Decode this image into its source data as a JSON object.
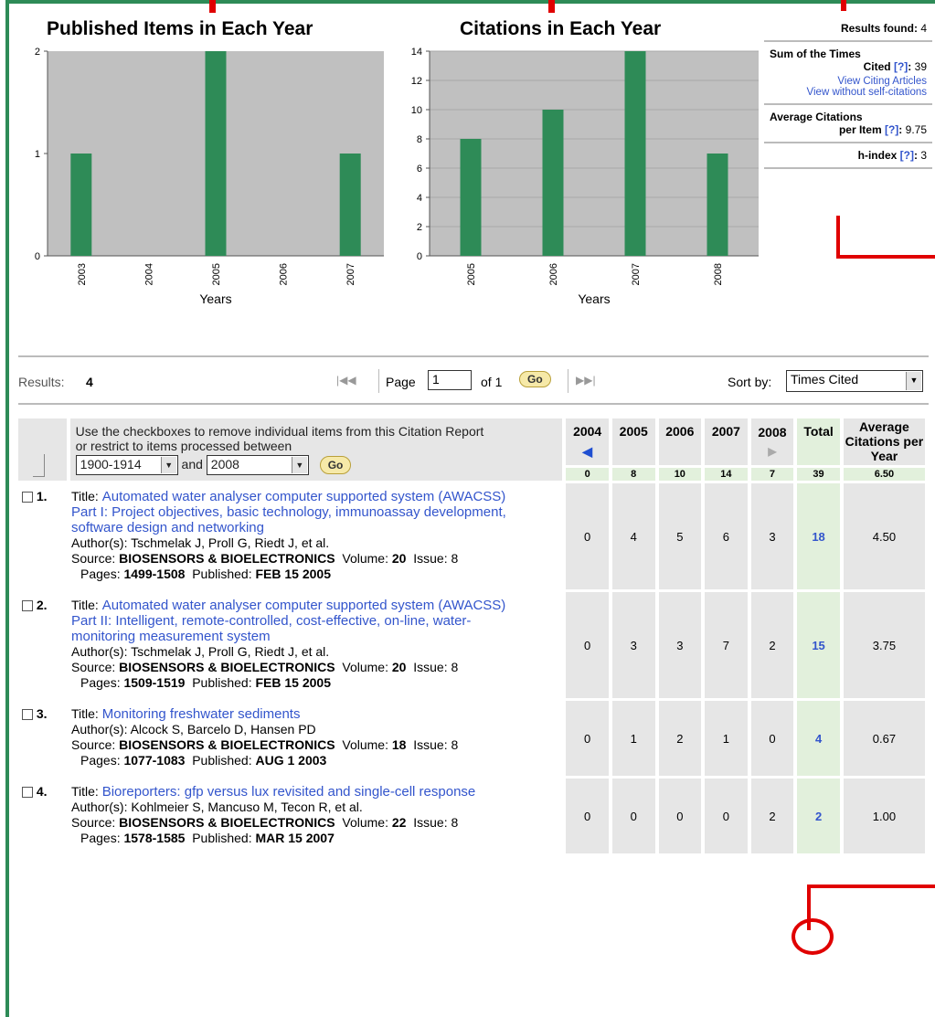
{
  "charts": [
    {
      "title": "Published Items in Each Year",
      "chart_data": {
        "type": "bar",
        "title": "Published Items in Each Year",
        "xlabel": "Years",
        "ylabel": "",
        "categories": [
          "2003",
          "2004",
          "2005",
          "2006",
          "2007"
        ],
        "values": [
          1,
          0,
          2,
          0,
          1
        ],
        "ylim": [
          0,
          2
        ],
        "yticks": [
          0,
          1,
          2
        ],
        "grid": false,
        "bar_color": "#2e8b57",
        "bg_color": "#c0c0c0"
      }
    },
    {
      "title": "Citations in Each Year",
      "chart_data": {
        "type": "bar",
        "title": "Citations in Each Year",
        "xlabel": "Years",
        "ylabel": "",
        "categories": [
          "2005",
          "2006",
          "2007",
          "2008"
        ],
        "values": [
          8,
          10,
          14,
          7
        ],
        "ylim": [
          0,
          14
        ],
        "yticks": [
          0,
          2,
          4,
          6,
          8,
          10,
          12,
          14
        ],
        "grid": true,
        "bar_color": "#2e8b57",
        "bg_color": "#c0c0c0"
      }
    }
  ],
  "chart_data": [
    {
      "type": "bar",
      "title": "Published Items in Each Year",
      "xlabel": "Years",
      "categories": [
        "2003",
        "2004",
        "2005",
        "2006",
        "2007"
      ],
      "values": [
        1,
        0,
        2,
        0,
        1
      ],
      "ylim": [
        0,
        2
      ]
    },
    {
      "type": "bar",
      "title": "Citations in Each Year",
      "xlabel": "Years",
      "categories": [
        "2005",
        "2006",
        "2007",
        "2008"
      ],
      "values": [
        8,
        10,
        14,
        7
      ],
      "ylim": [
        0,
        14
      ]
    }
  ],
  "stats": {
    "results_found_label": "Results found:",
    "results_found": "4",
    "sum_label_1": "Sum of the Times",
    "sum_label_2": "Cited",
    "help": "[?]",
    "sum_value": "39",
    "view_citing": "View Citing Articles",
    "view_without": "View without self-citations",
    "avg_label_1": "Average Citations",
    "avg_label_2": "per Item",
    "avg_value": "9.75",
    "h_label": "h-index",
    "h_value": "3"
  },
  "results_bar": {
    "results_label": "Results:",
    "results_count": "4",
    "page_label": "Page",
    "page_value": "1",
    "of_label": "of 1",
    "go": "Go",
    "sort_label": "Sort by:",
    "sort_value": "Times Cited"
  },
  "table": {
    "instructions_1": "Use the checkboxes to remove individual items from this Citation Report",
    "instructions_2": "or restrict to items processed between",
    "from_year": "1900-1914",
    "and_label": "and",
    "to_year": "2008",
    "go": "Go",
    "years": [
      "2004",
      "2005",
      "2006",
      "2007",
      "2008"
    ],
    "total_header": "Total",
    "avg_header": "Average Citations per Year",
    "totals": [
      "0",
      "8",
      "10",
      "14",
      "7",
      "39",
      "6.50"
    ],
    "rows": [
      {
        "num": "1.",
        "title_label": "Title:",
        "title": "Automated water analyser computer supported system (AWACSS) Part I: Project objectives, basic technology, immunoassay development, software design and networking",
        "authors": "Author(s): Tschmelak J, Proll G, Riedt J, et al.",
        "source_label": "Source:",
        "source": "BIOSENSORS & BIOELECTRONICS",
        "volume_label": "Volume:",
        "volume": "20",
        "issue_label": "Issue:",
        "issue": "8",
        "pages_label": "Pages:",
        "pages": "1499-1508",
        "published_label": "Published:",
        "published": "FEB 15 2005",
        "counts": [
          "0",
          "4",
          "5",
          "6",
          "3"
        ],
        "total": "18",
        "avg": "4.50"
      },
      {
        "num": "2.",
        "title_label": "Title:",
        "title": "Automated water analyser computer supported system (AWACSS) Part II: Intelligent, remote-controlled, cost-effective, on-line, water-monitoring measurement system",
        "authors": "Author(s): Tschmelak J, Proll G, Riedt J, et al.",
        "source_label": "Source:",
        "source": "BIOSENSORS & BIOELECTRONICS",
        "volume_label": "Volume:",
        "volume": "20",
        "issue_label": "Issue:",
        "issue": "8",
        "pages_label": "Pages:",
        "pages": "1509-1519",
        "published_label": "Published:",
        "published": "FEB 15 2005",
        "counts": [
          "0",
          "3",
          "3",
          "7",
          "2"
        ],
        "total": "15",
        "avg": "3.75"
      },
      {
        "num": "3.",
        "title_label": "Title:",
        "title": "Monitoring freshwater sediments",
        "authors": "Author(s): Alcock S, Barcelo D, Hansen PD",
        "source_label": "Source:",
        "source": "BIOSENSORS & BIOELECTRONICS",
        "volume_label": "Volume:",
        "volume": "18",
        "issue_label": "Issue:",
        "issue": "8",
        "pages_label": "Pages:",
        "pages": "1077-1083",
        "published_label": "Published:",
        "published": "AUG 1 2003",
        "counts": [
          "0",
          "1",
          "2",
          "1",
          "0"
        ],
        "total": "4",
        "avg": "0.67"
      },
      {
        "num": "4.",
        "title_label": "Title:",
        "title": "Bioreporters: gfp versus lux revisited and single-cell response",
        "authors": "Author(s): Kohlmeier S, Mancuso M, Tecon R, et al.",
        "source_label": "Source:",
        "source": "BIOSENSORS & BIOELECTRONICS",
        "volume_label": "Volume:",
        "volume": "22",
        "issue_label": "Issue:",
        "issue": "8",
        "pages_label": "Pages:",
        "pages": "1578-1585",
        "published_label": "Published:",
        "published": "MAR 15 2007",
        "counts": [
          "0",
          "0",
          "0",
          "0",
          "2"
        ],
        "total": "2",
        "avg": "1.00"
      }
    ]
  },
  "colors": {
    "frame_green": "#2e8b57",
    "bar_green": "#2e8b57",
    "annotation_red": "#e00000",
    "link_blue": "#3355cc",
    "cell_grey": "#e6e6e6",
    "cell_green": "#e2f0dc"
  },
  "icons": [
    "first-page-icon",
    "prev-page-icon",
    "next-page-icon",
    "last-page-icon",
    "prev-year-arrow-icon",
    "next-year-arrow-icon",
    "dropdown-arrow-icon",
    "restrict-arrow-icon"
  ]
}
